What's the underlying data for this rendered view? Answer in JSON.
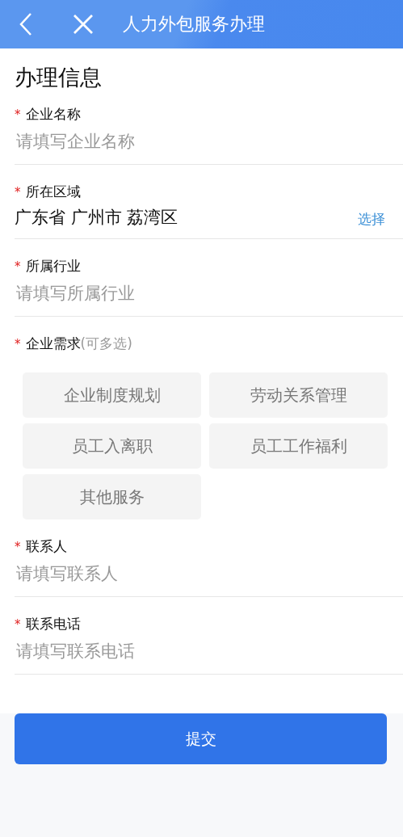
{
  "header": {
    "title": "人力外包服务办理"
  },
  "section_title": "办理信息",
  "fields": [
    {
      "kind": "text",
      "mark": "*",
      "label": "企业名称",
      "placeholder": "请填写企业名称"
    },
    {
      "kind": "select",
      "mark": "*",
      "label": "所在区域",
      "value": "广东省 广州市 荔湾区",
      "action": "选择"
    },
    {
      "kind": "text",
      "mark": "*",
      "label": "所属行业",
      "placeholder": "请填写所属行业"
    },
    {
      "kind": "options",
      "mark": "*",
      "label": "企业需求",
      "hint": "(可多选)",
      "options": [
        {
          "label": "企业制度规划",
          "selected": false
        },
        {
          "label": "劳动关系管理",
          "selected": false
        },
        {
          "label": "员工入离职",
          "selected": false
        },
        {
          "label": "员工工作福利",
          "selected": false
        },
        {
          "label": "其他服务",
          "selected": false
        }
      ]
    },
    {
      "kind": "text",
      "mark": "*",
      "label": "联系人",
      "placeholder": "请填写联系人"
    },
    {
      "kind": "text",
      "mark": "*",
      "label": "联系电话",
      "placeholder": "请填写联系电话"
    }
  ],
  "submit": "提交"
}
